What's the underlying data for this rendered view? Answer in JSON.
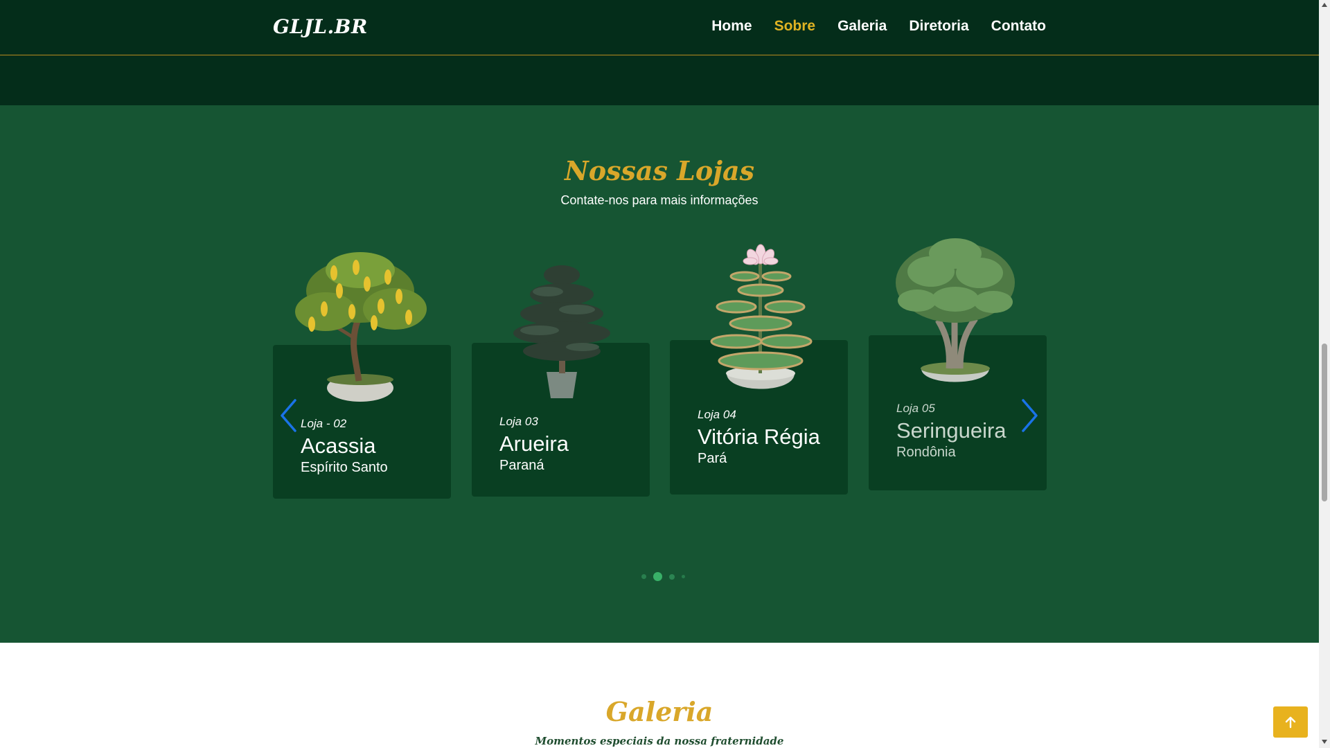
{
  "header": {
    "brand": "GLJL.BR",
    "nav": [
      {
        "label": "Home",
        "active": false
      },
      {
        "label": "Sobre",
        "active": true
      },
      {
        "label": "Galeria",
        "active": false
      },
      {
        "label": "Diretoria",
        "active": false
      },
      {
        "label": "Contato",
        "active": false
      }
    ]
  },
  "stores": {
    "title": "Nossas Lojas",
    "subtitle": "Contate-nos para mais informações",
    "cards": [
      {
        "loja": "Loja - 02",
        "name": "Acassia",
        "state": "Espírito Santo"
      },
      {
        "loja": "Loja 03",
        "name": "Arueira",
        "state": "Paraná"
      },
      {
        "loja": "Loja 04",
        "name": "Vitória Régia",
        "state": "Pará"
      },
      {
        "loja": "Loja 05",
        "name": "Seringueira",
        "state": "Rondônia"
      }
    ],
    "carousel": {
      "pages": 4,
      "active_page": 2
    }
  },
  "galeria": {
    "title": "Galeria",
    "subtitle": "Momentos especiais da nossa fraternidade"
  },
  "colors": {
    "header_bg": "#042d1a",
    "section_bg": "#165533",
    "card_bg": "#093f22",
    "accent_gold": "#e0b323",
    "arrow_blue": "#1a73e8"
  },
  "icons": {
    "prev": "chevron-left-icon",
    "next": "chevron-right-icon",
    "back_to_top": "arrow-up-icon"
  }
}
